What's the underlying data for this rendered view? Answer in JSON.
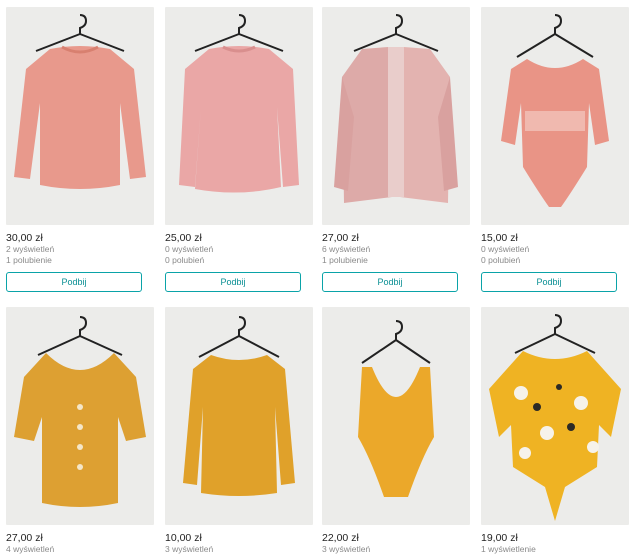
{
  "listings": [
    {
      "price": "30,00 zł",
      "views": "2 wyświetleń",
      "likes": "1 polubienie",
      "boost": "Podbij",
      "item": "pink-knit-sweater-photo",
      "color": "#e8998c"
    },
    {
      "price": "25,00 zł",
      "views": "0 wyświetleń",
      "likes": "0 polubień",
      "boost": "Podbij",
      "item": "pink-sweater-photo",
      "color": "#eaa7a6"
    },
    {
      "price": "27,00 zł",
      "views": "6 wyświetleń",
      "likes": "1 polubienie",
      "boost": "Podbij",
      "item": "pink-cardigan-photo",
      "color": "#e3b3b0"
    },
    {
      "price": "15,00 zł",
      "views": "0 wyświetleń",
      "likes": "0 polubień",
      "boost": "Podbij",
      "item": "coral-bodysuit-photo",
      "color": "#e99486"
    },
    {
      "price": "27,00 zł",
      "views": "4 wyświetleń",
      "likes": "",
      "boost": "",
      "item": "mustard-blouse-photo",
      "color": "#dda032"
    },
    {
      "price": "10,00 zł",
      "views": "3 wyświetleń",
      "likes": "",
      "boost": "",
      "item": "mustard-longsleeve-photo",
      "color": "#e0a12a"
    },
    {
      "price": "22,00 zł",
      "views": "3 wyświetleń",
      "likes": "",
      "boost": "",
      "item": "yellow-bodysuit-photo",
      "color": "#eba82a"
    },
    {
      "price": "19,00 zł",
      "views": "1 wyświetlenie",
      "likes": "",
      "boost": "",
      "item": "yellow-floral-top-photo",
      "color": "#efb323"
    }
  ]
}
